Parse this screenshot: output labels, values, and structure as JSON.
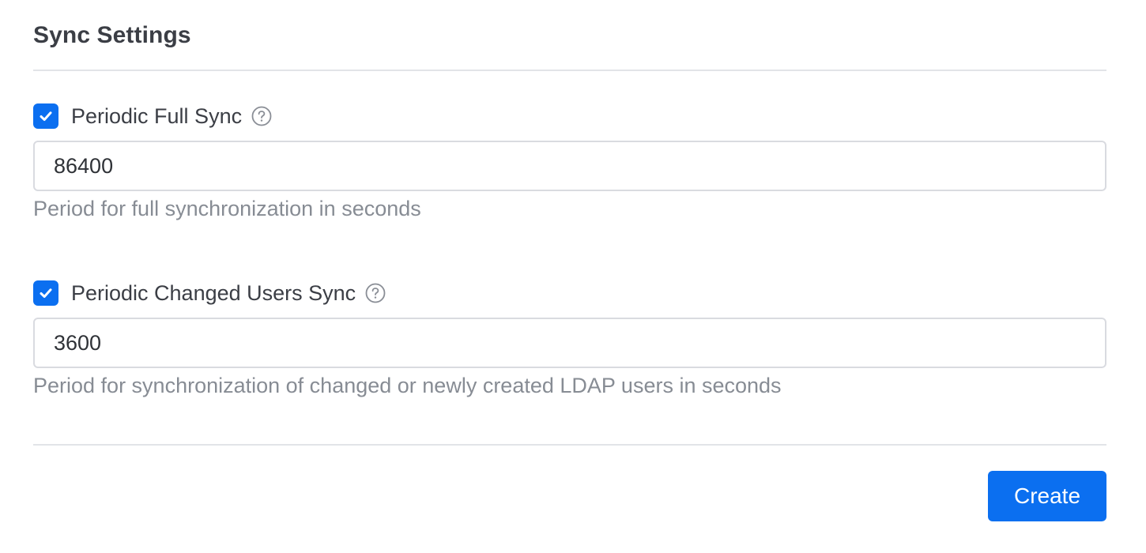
{
  "section": {
    "title": "Sync Settings"
  },
  "full_sync": {
    "label": "Periodic Full Sync",
    "checked": true,
    "value": "86400",
    "help_text": "Period for full synchronization in seconds",
    "info_icon": "question-circle-icon"
  },
  "changed_users_sync": {
    "label": "Periodic Changed Users Sync",
    "checked": true,
    "value": "3600",
    "help_text": "Period for synchronization of changed or newly created LDAP users in seconds",
    "info_icon": "question-circle-icon"
  },
  "footer": {
    "create_label": "Create"
  },
  "colors": {
    "accent": "#0b6ff0",
    "text": "#3b3e45",
    "muted": "#878c94",
    "border": "#d9dbe0",
    "divider": "#e2e4e8"
  }
}
